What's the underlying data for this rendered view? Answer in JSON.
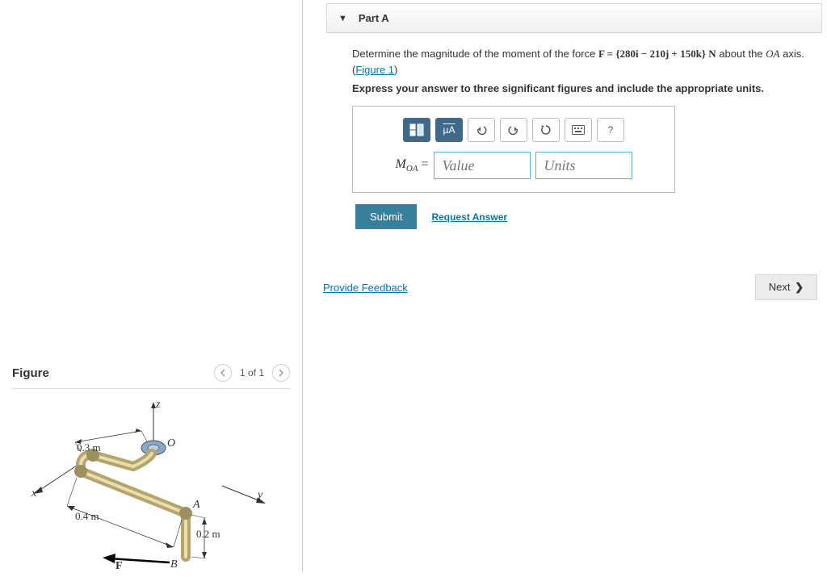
{
  "left": {
    "figure_title": "Figure",
    "pager": "1 of 1",
    "labels": {
      "z": "z",
      "x": "x",
      "y": "y",
      "O": "O",
      "A": "A",
      "B": "B",
      "F": "F"
    },
    "dims": {
      "d1": "0.3 m",
      "d2": "0.4 m",
      "d3": "0.2 m"
    }
  },
  "right": {
    "part_label": "Part A",
    "prompt_pre": "Determine the magnitude of the moment of the force ",
    "F_eq": "F = {280i  −  210j  +  150k} N",
    "prompt_mid": " about the ",
    "axis_name": "OA",
    "prompt_post": " axis. (",
    "fig_link": "Figure 1",
    "prompt_close": ")",
    "instruction": "Express your answer to three significant figures and include the appropriate units.",
    "toolbar": {
      "units_btn": "µA",
      "help": "?"
    },
    "label_MOA": "M",
    "label_MOA_sub": "OA",
    "equals": " = ",
    "value_ph": "Value",
    "units_ph": "Units",
    "submit": "Submit",
    "request_answer": "Request Answer",
    "provide_feedback": "Provide Feedback",
    "next": "Next "
  }
}
